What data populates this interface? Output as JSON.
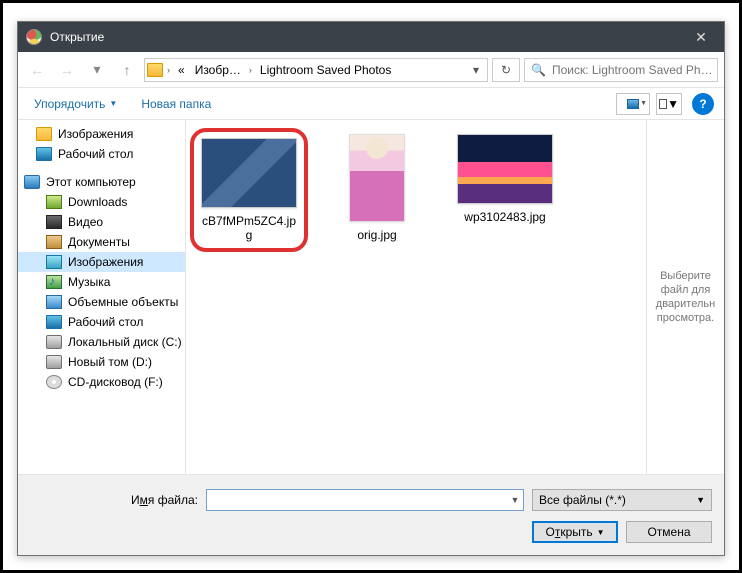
{
  "title": "Открытие",
  "nav": {
    "back": "←",
    "fwd": "→",
    "recent": "▾",
    "up": "↑"
  },
  "crumbs": {
    "lead": "«",
    "c1": "Изобр…",
    "c2": "Lightroom Saved Photos",
    "drop": "▾",
    "refresh": "↻"
  },
  "search": {
    "placeholder": "Поиск: Lightroom Saved Ph…",
    "icon": "🔍"
  },
  "toolbar": {
    "organize": "Упорядочить",
    "newfolder": "Новая папка",
    "help": "?"
  },
  "tree": {
    "items": [
      {
        "icon": "folder",
        "label": "Изображения"
      },
      {
        "icon": "desktop",
        "label": "Рабочий стол"
      },
      {
        "icon": "pc",
        "label": "Этот компьютер",
        "root": true
      },
      {
        "icon": "dl",
        "label": "Downloads"
      },
      {
        "icon": "vid",
        "label": "Видео"
      },
      {
        "icon": "doc",
        "label": "Документы"
      },
      {
        "icon": "img",
        "label": "Изображения",
        "sel": true
      },
      {
        "icon": "mus",
        "label": "Музыка"
      },
      {
        "icon": "obj",
        "label": "Объемные объекты"
      },
      {
        "icon": "desktop",
        "label": "Рабочий стол"
      },
      {
        "icon": "disk",
        "label": "Локальный диск (C:)"
      },
      {
        "icon": "disk",
        "label": "Новый том (D:)"
      },
      {
        "icon": "cd",
        "label": "CD-дисковод (F:)"
      }
    ]
  },
  "files": [
    {
      "name": "cB7fMPm5ZC4.jpg",
      "pic": "p1",
      "hl": true
    },
    {
      "name": "orig.jpg",
      "pic": "p2"
    },
    {
      "name": "wp3102483.jpg",
      "pic": "p3"
    }
  ],
  "preview": "Выберите файл для дварительн просмотра.",
  "bottom": {
    "fnlabel_pre": "И",
    "fnlabel_u": "м",
    "fnlabel_post": "я файла:",
    "filter": "Все файлы (*.*)",
    "open_pre": "О",
    "open_u": "т",
    "open_post": "крыть",
    "cancel": "Отмена"
  }
}
